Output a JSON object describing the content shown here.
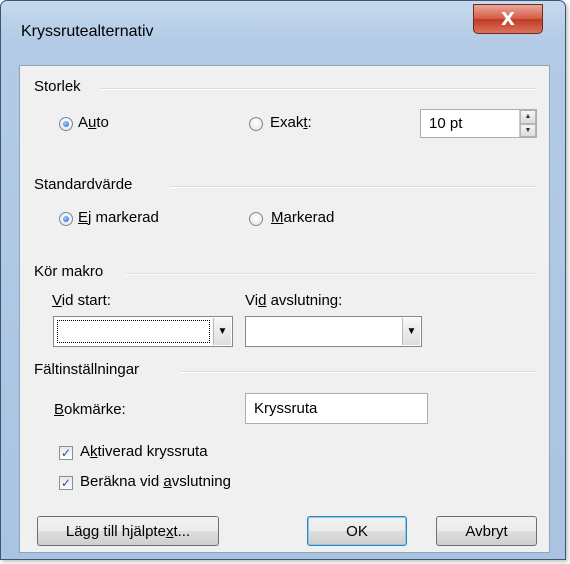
{
  "window": {
    "title": "Kryssrutealternativ",
    "close_glyph": "X"
  },
  "size_group": {
    "label": "Storlek",
    "auto": {
      "pre": "A",
      "ul": "u",
      "post": "to",
      "checked": true
    },
    "exact": {
      "pre": "Exak",
      "ul": "t",
      "post": ":",
      "checked": false
    },
    "exact_value": "10 pt"
  },
  "default_group": {
    "label": "Standardvärde",
    "not_checked": {
      "pre": "",
      "ul": "E",
      "post": "j markerad",
      "checked": true
    },
    "checked": {
      "pre": "",
      "ul": "M",
      "post": "arkerad",
      "checked": false
    }
  },
  "macro_group": {
    "label": "Kör makro",
    "on_entry": {
      "pre": "",
      "ul": "V",
      "post": "id start:",
      "value": ""
    },
    "on_exit": {
      "pre": "Vi",
      "ul": "d",
      "post": " avslutning:",
      "value": ""
    }
  },
  "field_group": {
    "label": "Fältinställningar",
    "bookmark": {
      "pre": "",
      "ul": "B",
      "post": "okmärke:",
      "value": "Kryssruta"
    },
    "enabled": {
      "pre": "A",
      "ul": "k",
      "post": "tiverad kryssruta",
      "checked": true
    },
    "calc_on_exit": {
      "pre": "Beräkna vid ",
      "ul": "a",
      "post": "vslutning",
      "checked": true
    }
  },
  "buttons": {
    "help": {
      "pre": "Lägg till hjälpte",
      "ul": "x",
      "post": "t..."
    },
    "ok": "OK",
    "cancel": "Avbryt"
  },
  "icons": {
    "dropdown": "chevron-down-icon",
    "spin_up": "spin-up-icon",
    "spin_down": "spin-down-icon",
    "check": "check-icon"
  }
}
